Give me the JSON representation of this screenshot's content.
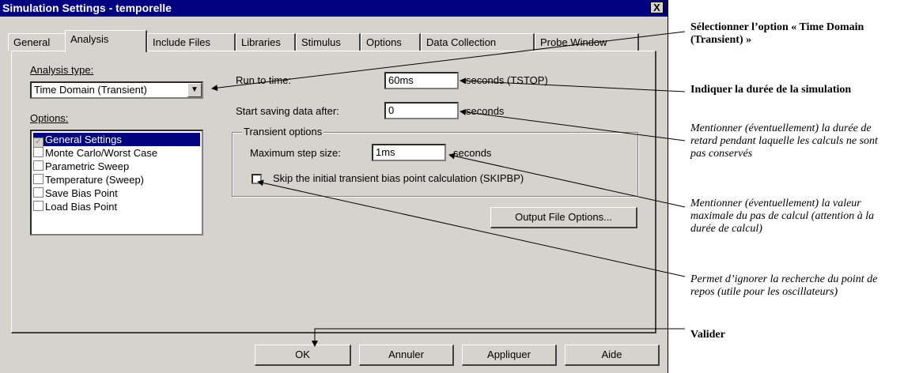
{
  "window": {
    "title": "Simulation Settings - temporelle",
    "close_label": "X"
  },
  "tabs": [
    "General",
    "Analysis",
    "Include Files",
    "Libraries",
    "Stimulus",
    "Options",
    "Data Collection",
    "Probe Window"
  ],
  "analysis": {
    "analysis_type_label": "Analysis type:",
    "analysis_type_value": "Time Domain (Transient)",
    "options_label": "Options:",
    "options_items": [
      "General Settings",
      "Monte Carlo/Worst Case",
      "Parametric Sweep",
      "Temperature (Sweep)",
      "Save Bias Point",
      "Load Bias Point"
    ],
    "run_to_time_label": "Run to time:",
    "run_to_time_value": "60ms",
    "run_to_time_unit": "seconds (TSTOP)",
    "start_saving_label": "Start saving data after:",
    "start_saving_value": "0",
    "start_saving_unit": "seconds",
    "transient_options_label": "Transient options",
    "max_step_label": "Maximum step size:",
    "max_step_value": "1ms",
    "max_step_unit": "seconds",
    "skip_bias_label": "Skip the initial transient bias point calculation (SKIPBP)",
    "output_file_options_label": "Output File Options..."
  },
  "buttons": {
    "ok": "OK",
    "cancel": "Annuler",
    "apply": "Appliquer",
    "help": "Aide"
  },
  "annotations": {
    "select_option": "Sélectionner l’option « Time Domain (Transient) »",
    "duration": "Indiquer la durée de la simulation",
    "delay": "Mentionner (éventuellement) la durée de retard pendant laquelle les calculs ne sont pas conservés",
    "max_step": "Mentionner (éventuellement) la valeur maximale du pas de calcul (attention à la durée de calcul)",
    "skip_bias": "Permet d’ignorer la recherche du point de repos (utile pour les oscillateurs)",
    "validate": "Valider"
  }
}
